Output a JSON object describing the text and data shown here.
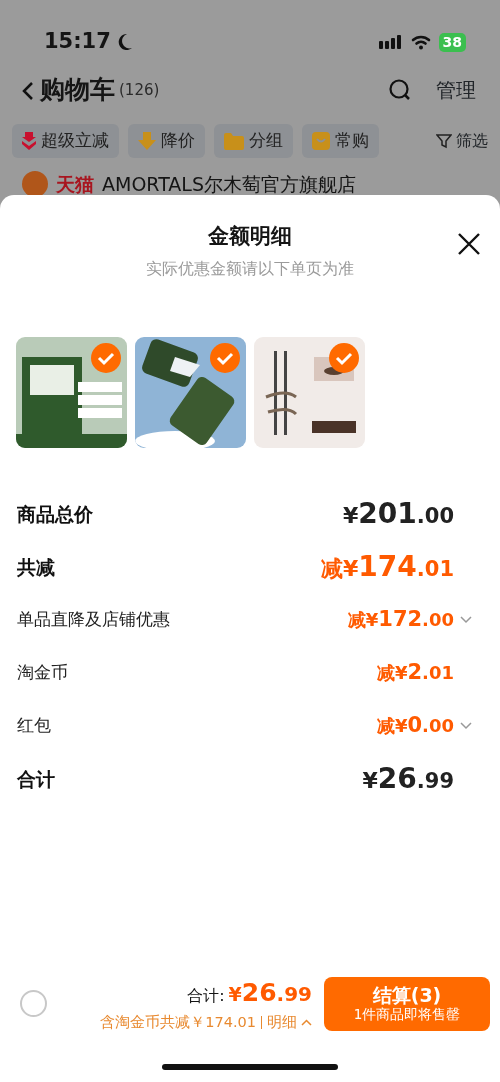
{
  "status_bar": {
    "time": "15:17",
    "battery": "38"
  },
  "nav": {
    "title": "购物车",
    "count": "(126)",
    "action": "管理"
  },
  "chips": [
    {
      "kind": "super",
      "label": "超级立减"
    },
    {
      "kind": "down",
      "label": "降价"
    },
    {
      "kind": "folder",
      "label": "分组"
    },
    {
      "kind": "bag",
      "label": "常购"
    }
  ],
  "filter": "筛选",
  "store": {
    "tag": "天猫",
    "name": "AMORTALS尔木萄官方旗舰店"
  },
  "sheet": {
    "title": "金额明细",
    "subtitle": "实际优惠金额请以下单页为准",
    "products": [
      {
        "kind": "picture",
        "selected": true
      },
      {
        "kind": "picture",
        "selected": true
      },
      {
        "kind": "picture",
        "selected": true
      }
    ],
    "rows": [
      {
        "label": "商品总价",
        "value": "¥201.00",
        "kind": "total",
        "expandable": false
      },
      {
        "label": "共减",
        "value": "减¥174.01",
        "kind": "discount-total",
        "expandable": false
      },
      {
        "label": "单品直降及店铺优惠",
        "value": "减¥172.00",
        "kind": "discount",
        "expandable": true
      },
      {
        "label": "淘金币",
        "value": "减¥2.01",
        "kind": "discount",
        "expandable": false
      },
      {
        "label": "红包",
        "value": "减¥0.00",
        "kind": "discount",
        "expandable": true
      },
      {
        "label": "合计",
        "value": "¥26.99",
        "kind": "total",
        "expandable": false
      }
    ]
  },
  "footer": {
    "select_all": {
      "checked": false
    },
    "total_label": "合计:",
    "total": "¥26.99",
    "note": "含淘金币共减￥174.01",
    "detail": "明细",
    "checkout": "结算(3)",
    "checkout_note": "1件商品即将售罄"
  }
}
